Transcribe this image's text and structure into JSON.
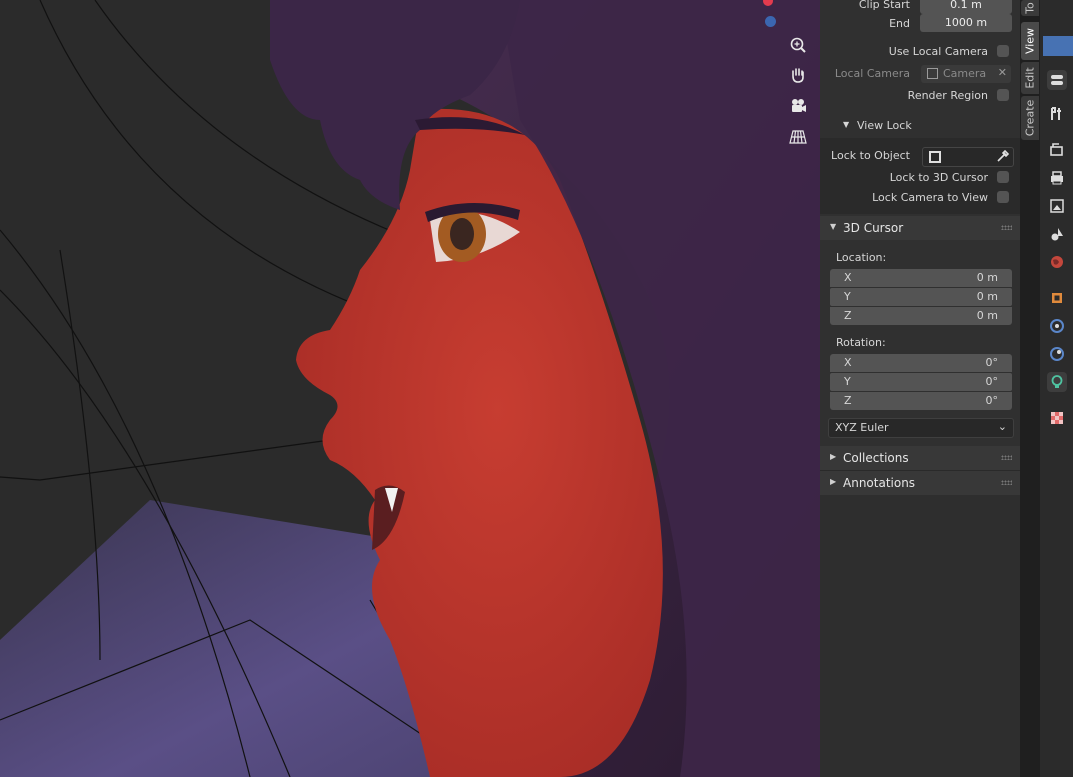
{
  "view_panel": {
    "clip_start_label": "Clip Start",
    "clip_start_value": "0.1 m",
    "clip_end_label": "End",
    "clip_end_value": "1000 m",
    "use_local_camera_label": "Use Local Camera",
    "local_camera_label": "Local Camera",
    "local_camera_value": "Camera",
    "render_region_label": "Render Region"
  },
  "view_lock": {
    "title": "View Lock",
    "lock_to_object_label": "Lock to Object",
    "lock_to_3d_cursor_label": "Lock to 3D Cursor",
    "lock_camera_to_view_label": "Lock Camera to View"
  },
  "cursor_panel": {
    "title": "3D Cursor",
    "location_label": "Location:",
    "location": [
      {
        "axis": "X",
        "value": "0 m"
      },
      {
        "axis": "Y",
        "value": "0 m"
      },
      {
        "axis": "Z",
        "value": "0 m"
      }
    ],
    "rotation_label": "Rotation:",
    "rotation": [
      {
        "axis": "X",
        "value": "0°"
      },
      {
        "axis": "Y",
        "value": "0°"
      },
      {
        "axis": "Z",
        "value": "0°"
      }
    ],
    "rotation_mode": "XYZ Euler"
  },
  "collapsed_panels": [
    "Collections",
    "Annotations"
  ],
  "sidebar_tabs": [
    "To",
    "View",
    "Edit",
    "Create"
  ],
  "active_tab": "View",
  "properties_icons": [
    "tool-icon",
    "render-icon",
    "output-icon",
    "view-layer-icon",
    "scene-icon",
    "world-icon",
    "object-icon",
    "modifier-icon",
    "particles-icon",
    "physics-icon",
    "material-icon",
    "texture-icon"
  ],
  "colors": {
    "skin": "#c2382e",
    "hair": "#3a2540",
    "panel_bg": "#303030",
    "field_bg": "#545454",
    "accent_blue": "#4772b3"
  }
}
